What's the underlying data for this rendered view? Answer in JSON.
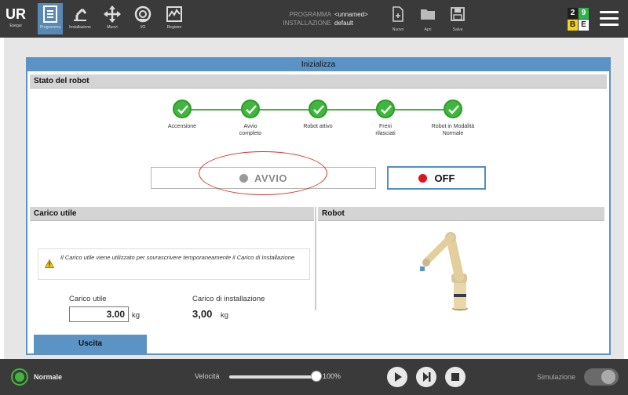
{
  "topbar": {
    "logo_label": "Esegui",
    "nav": [
      {
        "label": "Programma",
        "icon": "program-icon",
        "active": true
      },
      {
        "label": "Installazione",
        "icon": "installation-icon"
      },
      {
        "label": "Muovi",
        "icon": "move-icon"
      },
      {
        "label": "I/O",
        "icon": "io-icon"
      },
      {
        "label": "Registro",
        "icon": "log-icon"
      }
    ],
    "program_key": "PROGRAMMA",
    "program_value": "<unnamed>",
    "installation_key": "INSTALLAZIONE",
    "installation_value": "default",
    "file_buttons": [
      {
        "label": "Nuovo",
        "icon": "new-file-icon"
      },
      {
        "label": "Apri",
        "icon": "open-folder-icon"
      },
      {
        "label": "Salva",
        "icon": "save-icon"
      }
    ],
    "badges": [
      "2",
      "9",
      "B",
      "E"
    ],
    "badge_colors": {
      "green": "#2db34a",
      "yellow": "#f2d21b",
      "white": "#ffffff",
      "dark": "#1f1f1f"
    }
  },
  "dialog": {
    "title": "Inizializza",
    "robot_state_title": "Stato del robot",
    "steps": [
      "Accensione",
      "Avvio completo",
      "Robot attivo",
      "Freni rilasciati",
      "Robot in Modalità Normale"
    ],
    "avvio_label": "AVVIO",
    "off_label": "OFF",
    "payload_title": "Carico utile",
    "payload_notice": "Il Carico utile viene utilizzato per sovrascrivere temporaneamente il Carico di Installazione.",
    "payload_label": "Carico utile",
    "payload_value": "3.00",
    "installation_payload_label": "Carico di installazione",
    "installation_payload_value": "3,00",
    "unit": "kg",
    "robot_title": "Robot",
    "exit_label": "Uscita"
  },
  "bottombar": {
    "status": "Normale",
    "speed_label": "Velocità",
    "speed_value": "100%",
    "speed_fraction": 1.0,
    "simulation_label": "Simulazione"
  },
  "colors": {
    "accent": "#5b93c5",
    "success": "#3fb73c",
    "danger": "#e0151b",
    "annotation": "#d9322c"
  }
}
